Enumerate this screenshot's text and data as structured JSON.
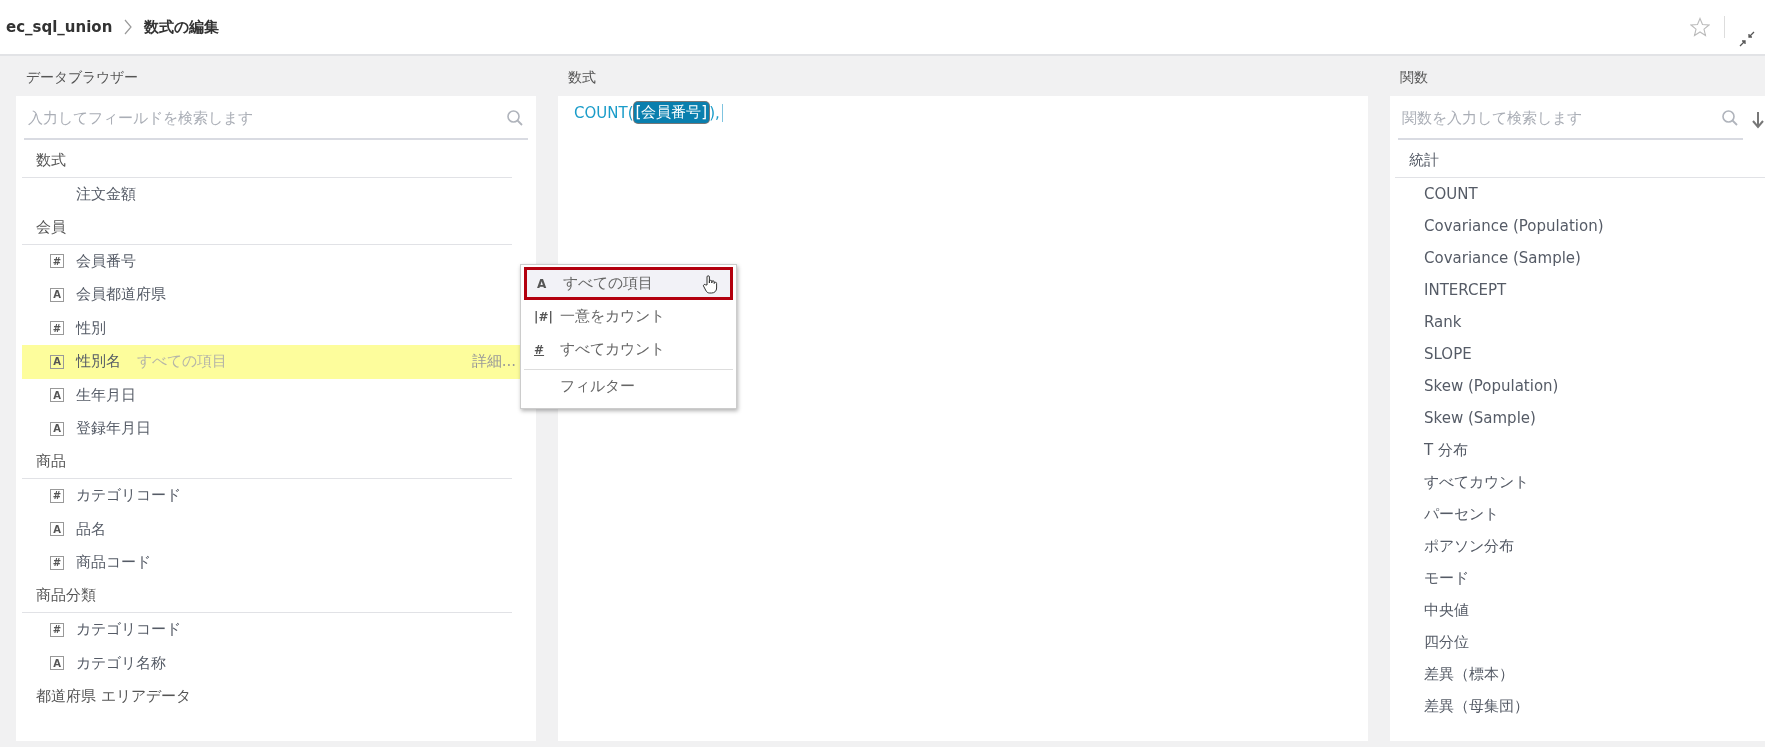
{
  "header": {
    "breadcrumb": [
      {
        "label": "ec_sql_union"
      },
      {
        "label": "数式の編集"
      }
    ]
  },
  "data_browser": {
    "title": "データブラウザー",
    "search": {
      "placeholder": "入力してフィールドを検索します"
    },
    "groups": [
      {
        "label": "数式",
        "fields": [
          {
            "kind": "formula",
            "name": "注文金額",
            "selected": false
          }
        ]
      },
      {
        "label": "会員",
        "fields": [
          {
            "kind": "number",
            "icon": "#",
            "name": "会員番号",
            "selected": false
          },
          {
            "kind": "text",
            "icon": "A",
            "name": "会員都道府県",
            "selected": false
          },
          {
            "kind": "number",
            "icon": "#",
            "name": "性別",
            "selected": false
          },
          {
            "kind": "text",
            "icon": "A",
            "name": "性別名",
            "selected": true,
            "aggregation": "すべての項目",
            "details": "詳細..."
          },
          {
            "kind": "text",
            "icon": "A",
            "name": "生年月日",
            "selected": false
          },
          {
            "kind": "text",
            "icon": "A",
            "name": "登録年月日",
            "selected": false
          }
        ]
      },
      {
        "label": "商品",
        "fields": [
          {
            "kind": "number",
            "icon": "#",
            "name": "カテゴリコード",
            "selected": false
          },
          {
            "kind": "text",
            "icon": "A",
            "name": "品名",
            "selected": false
          },
          {
            "kind": "number",
            "icon": "#",
            "name": "商品コード",
            "selected": false
          }
        ]
      },
      {
        "label": "商品分類",
        "fields": [
          {
            "kind": "number",
            "icon": "#",
            "name": "カテゴリコード",
            "selected": false
          },
          {
            "kind": "text",
            "icon": "A",
            "name": "カテゴリ名称",
            "selected": false
          }
        ]
      },
      {
        "label": "都道府県 エリアデータ"
      }
    ]
  },
  "context_menu": {
    "items": [
      {
        "icon": "A",
        "label": "すべての項目",
        "selected": true
      },
      {
        "icon": "|#|",
        "label": "一意をカウント",
        "selected": false
      },
      {
        "icon": "#",
        "label": "すべてカウント",
        "selected": false,
        "underline_icon": true
      },
      {
        "label": "フィルター",
        "selected": false,
        "separator_before": true
      }
    ]
  },
  "formula": {
    "title": "数式",
    "function": "COUNT(",
    "field": "[会員番号]",
    "suffix": "),"
  },
  "functions": {
    "title": "関数",
    "search": {
      "placeholder": "関数を入力して検索します"
    },
    "category": "統計",
    "items": [
      "COUNT",
      "Covariance (Population)",
      "Covariance (Sample)",
      "INTERCEPT",
      "Rank",
      "SLOPE",
      "Skew (Population)",
      "Skew (Sample)",
      "T 分布",
      "すべてカウント",
      "パーセント",
      "ポアソン分布",
      "モード",
      "中央値",
      "四分位",
      "差異（標本）",
      "差異（母集団）"
    ]
  }
}
